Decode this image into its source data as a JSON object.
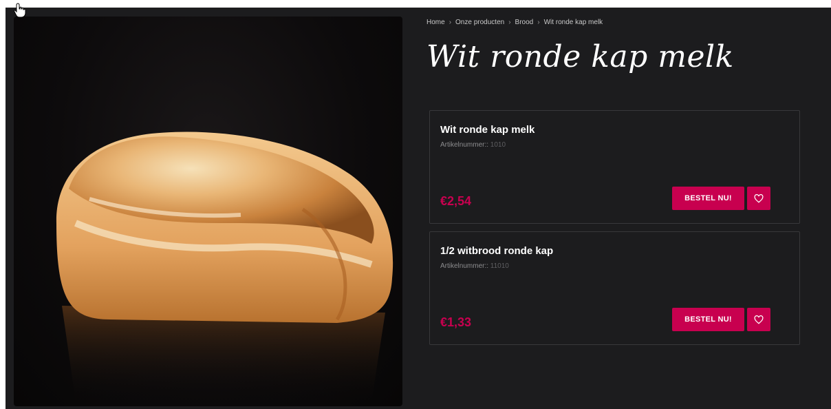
{
  "breadcrumb": {
    "items": [
      "Home",
      "Onze producten",
      "Brood",
      "Wit ronde kap melk"
    ],
    "separator": "›"
  },
  "page_title": "Wit ronde kap melk",
  "image": {
    "alt": "Wit ronde kap melk brood"
  },
  "products": [
    {
      "name": "Wit ronde kap melk",
      "sku_label": "Artikelnummer::",
      "sku": "1010",
      "price": "€2,54",
      "order_label": "BESTEL NU!",
      "favorite_icon": "heart-icon"
    },
    {
      "name": "1/2 witbrood ronde kap",
      "sku_label": "Artikelnummer::",
      "sku": "11010",
      "price": "€1,33",
      "order_label": "BESTEL NU!",
      "favorite_icon": "heart-icon"
    }
  ],
  "colors": {
    "background": "#1c1c1e",
    "accent": "#c8004f",
    "card_border": "#38383b",
    "text": "#ffffff",
    "muted": "#8d8d8f"
  }
}
